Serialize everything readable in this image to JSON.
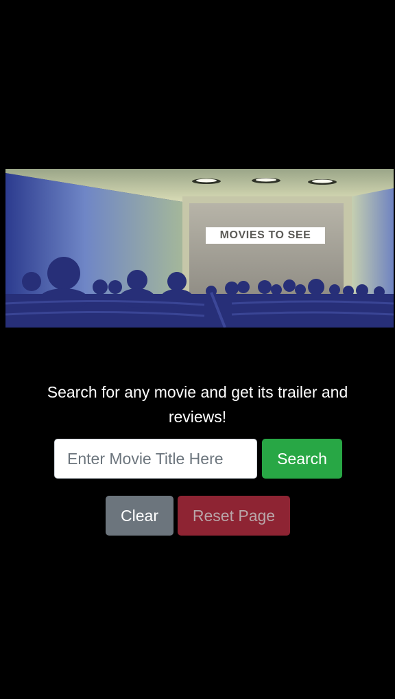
{
  "hero": {
    "label": "MOVIES TO SEE"
  },
  "main": {
    "tagline": "Search for any movie and get its trailer and reviews!",
    "search_placeholder": "Enter Movie Title Here",
    "search_value": "",
    "search_button": "Search",
    "clear_button": "Clear",
    "reset_button": "Reset Page"
  },
  "colors": {
    "background": "#000000",
    "search_button": "#28a745",
    "clear_button": "#6c757d",
    "reset_button": "#8e2433"
  }
}
